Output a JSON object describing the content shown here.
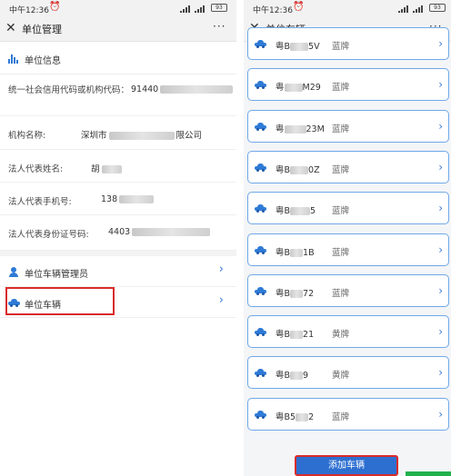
{
  "status": {
    "time": "中午12:36",
    "battery": "93"
  },
  "left": {
    "title": "单位管理",
    "more": "···",
    "section_title": "单位信息",
    "info": [
      {
        "label": "统一社会信用代码或机构代码：",
        "value": "91440"
      },
      {
        "label": "机构名称:",
        "value": "深圳市",
        "value_suffix": "限公司"
      },
      {
        "label": "法人代表姓名:",
        "value": "胡"
      },
      {
        "label": "法人代表手机号:",
        "value": "138"
      },
      {
        "label": "法人代表身份证号码:",
        "value": "4403"
      }
    ],
    "menu": [
      {
        "label": "单位车辆管理员",
        "chevron": "›"
      },
      {
        "label": "单位车辆",
        "chevron": "›"
      }
    ]
  },
  "right": {
    "title": "单位车辆",
    "more": "···",
    "vehicles": [
      {
        "plate_prefix": "粤B",
        "plate_suffix": "5V",
        "color": "蓝牌"
      },
      {
        "plate_prefix": "粤",
        "plate_suffix": "M29",
        "color": "蓝牌"
      },
      {
        "plate_prefix": "粤",
        "plate_suffix": "23M",
        "color": "蓝牌"
      },
      {
        "plate_prefix": "粤B",
        "plate_suffix": "0Z",
        "color": "蓝牌"
      },
      {
        "plate_prefix": "粤B",
        "plate_suffix": "5",
        "color": "蓝牌"
      },
      {
        "plate_prefix": "粤B",
        "plate_suffix": "1B",
        "color": "蓝牌"
      },
      {
        "plate_prefix": "粤B",
        "plate_suffix": "72",
        "color": "蓝牌"
      },
      {
        "plate_prefix": "粤B",
        "plate_suffix": "21",
        "color": "黄牌"
      },
      {
        "plate_prefix": "粤B",
        "plate_suffix": "9",
        "color": "黄牌"
      },
      {
        "plate_prefix": "粤B5",
        "plate_suffix": "2",
        "color": "蓝牌"
      }
    ],
    "chevron": "›",
    "add_button": "添加车辆"
  }
}
